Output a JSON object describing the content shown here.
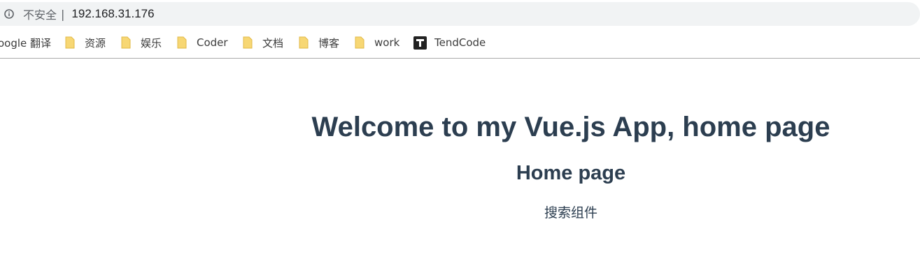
{
  "address_bar": {
    "security_label": "不安全",
    "separator": "|",
    "url": "192.168.31.176"
  },
  "bookmarks": [
    {
      "label": "oogle 翻译",
      "icon": "none"
    },
    {
      "label": "资源",
      "icon": "folder-icon"
    },
    {
      "label": "娱乐",
      "icon": "folder-icon"
    },
    {
      "label": "Coder",
      "icon": "folder-icon"
    },
    {
      "label": "文档",
      "icon": "folder-icon"
    },
    {
      "label": "博客",
      "icon": "folder-icon"
    },
    {
      "label": "work",
      "icon": "folder-icon"
    },
    {
      "label": "TendCode",
      "icon": "tendcode-icon"
    }
  ],
  "page": {
    "title": "Welcome to my Vue.js App, home page",
    "subtitle": "Home page",
    "component_text": "搜索组件"
  },
  "colors": {
    "heading": "#2c3e50",
    "folder": "#f7d774",
    "omnibox_bg": "#f1f3f4"
  }
}
